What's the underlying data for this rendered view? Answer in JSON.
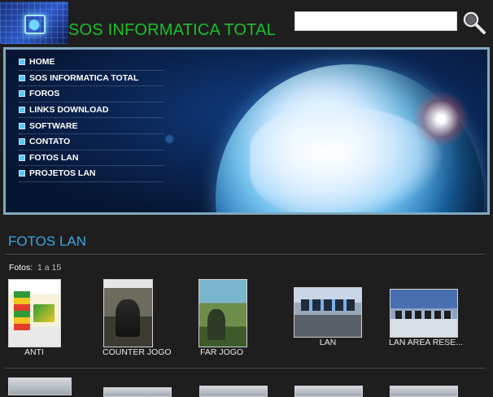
{
  "header": {
    "site_title": "SOS INFORMATICA TOTAL",
    "search": {
      "value": "",
      "placeholder": ""
    },
    "search_icon": "magnifier-icon",
    "logo_icon": "circuit-chip-icon"
  },
  "nav": {
    "items": [
      {
        "label": "HOME"
      },
      {
        "label": "SOS INFORMATICA TOTAL"
      },
      {
        "label": "FOROS"
      },
      {
        "label": "LINKS DOWNLOAD"
      },
      {
        "label": "SOFTWARE"
      },
      {
        "label": "CONTATO"
      },
      {
        "label": "FOTOS LAN"
      },
      {
        "label": "PROJETOS LAN"
      }
    ]
  },
  "section": {
    "title": "FOTOS LAN",
    "fotos_label": "Fotos:",
    "fotos_range": "1 a 15"
  },
  "thumbnails": [
    {
      "caption": "ANTI"
    },
    {
      "caption": "COUNTER JOGO"
    },
    {
      "caption": "FAR JOGO"
    },
    {
      "caption": "LAN"
    },
    {
      "caption": "LAN AREA RESE..."
    }
  ],
  "colors": {
    "background": "#1e1e1e",
    "title_green": "#18c02a",
    "section_blue": "#3aa6e0",
    "banner_border": "#7ea9bf"
  }
}
